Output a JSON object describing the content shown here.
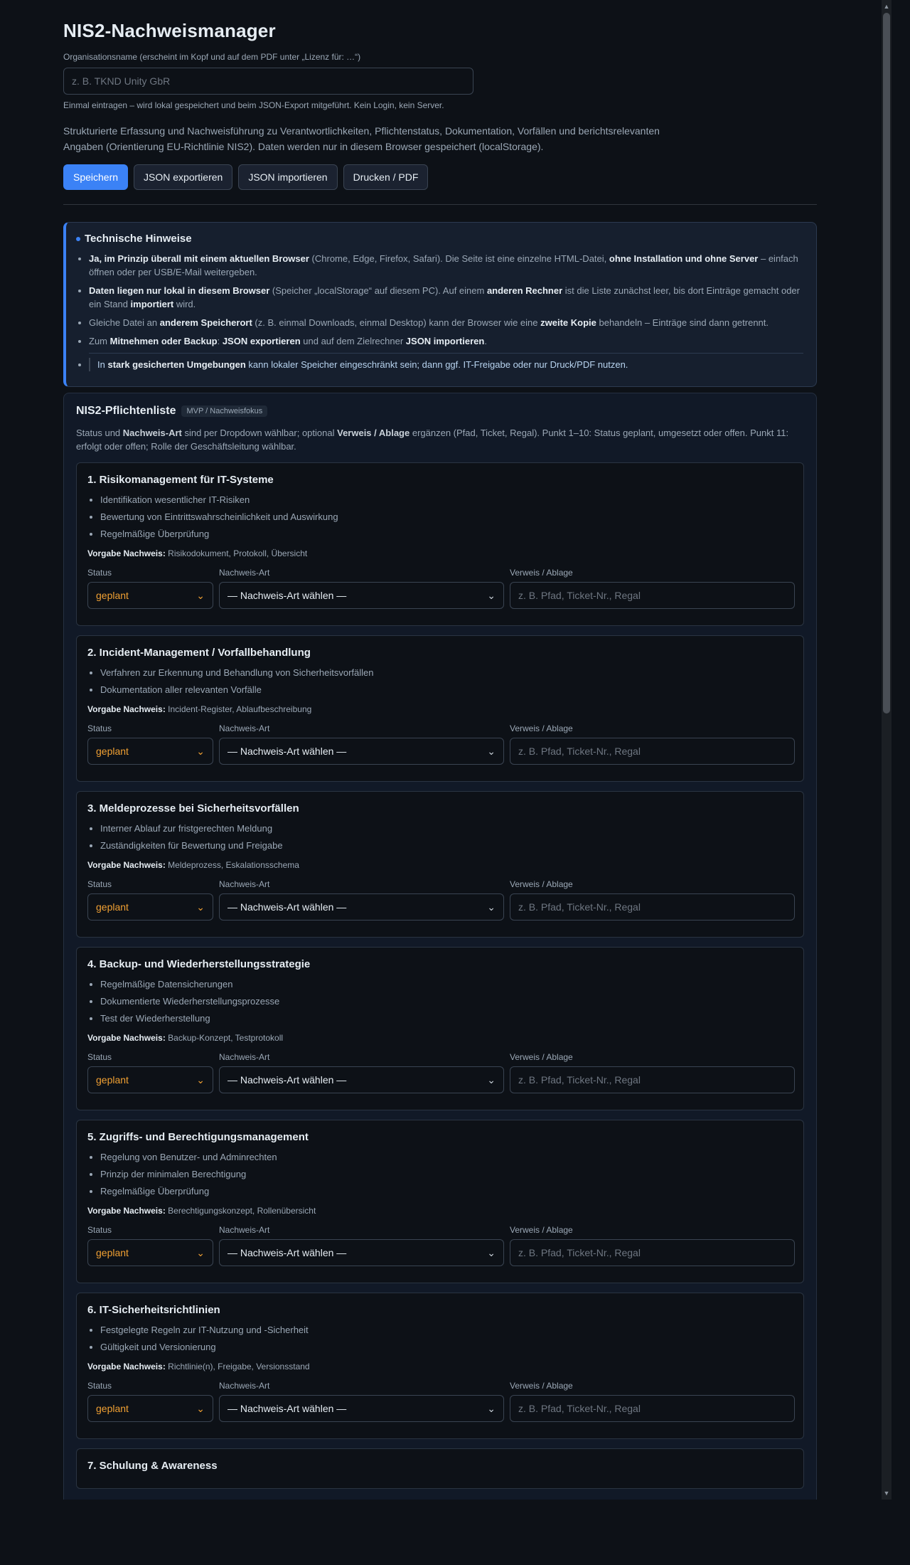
{
  "header": {
    "title": "NIS2-Nachweismanager",
    "org_label": "Organisationsname (erscheint im Kopf und auf dem PDF unter „Lizenz für: …“)",
    "org_placeholder": "z. B. TKND Unity GbR",
    "org_hint": "Einmal eintragen – wird lokal gespeichert und beim JSON-Export mitgeführt. Kein Login, kein Server.",
    "intro": "Strukturierte Erfassung und Nachweisführung zu Verantwortlichkeiten, Pflichtenstatus, Dokumentation, Vorfällen und berichtsrelevanten Angaben (Orientierung EU-Richtlinie NIS2). Daten werden nur in diesem Browser gespeichert (localStorage)."
  },
  "toolbar": {
    "save_label": "Speichern",
    "export_label": "JSON exportieren",
    "import_label": "JSON importieren",
    "print_label": "Drucken / PDF"
  },
  "hints": {
    "title": "Technische Hinweise",
    "items": [
      {
        "b1": "Ja, im Prinzip überall mit einem aktuellen Browser",
        "t1": " (Chrome, Edge, Firefox, Safari). Die Seite ist eine einzelne HTML-Datei, ",
        "b2": "ohne Installation und ohne Server",
        "t2": " – einfach öffnen oder per USB/E-Mail weitergeben."
      },
      {
        "b1": "Daten liegen nur lokal in diesem Browser",
        "t1": " (Speicher „localStorage“ auf diesem PC). Auf einem ",
        "b2": "anderen Rechner",
        "t2": " ist die Liste zunächst leer, bis dort Einträge gemacht oder ein Stand ",
        "b3": "importiert",
        "t3": " wird."
      },
      {
        "t0": "Gleiche Datei an ",
        "b1": "anderem Speicherort",
        "t1": " (z. B. einmal Downloads, einmal Desktop) kann der Browser wie eine ",
        "b2": "zweite Kopie",
        "t2": " behandeln – Einträge sind dann getrennt."
      },
      {
        "t0": "Zum ",
        "b1": "Mitnehmen oder Backup",
        "t1": ": ",
        "b2": "JSON exportieren",
        "t2": " und auf dem Zielrechner ",
        "b3": "JSON importieren",
        "t3": "."
      }
    ],
    "last_pre": "In ",
    "last_bold": "stark gesicherten Umgebungen",
    "last_post": " kann lokaler Speicher eingeschränkt sein; dann ggf. IT-Freigabe oder nur Druck/PDF nutzen."
  },
  "checklist": {
    "title": "NIS2-Pflichtenliste",
    "badge": "MVP / Nachweisfokus",
    "desc_pre": "Status und ",
    "desc_b1": "Nachweis-Art",
    "desc_mid": " sind per Dropdown wählbar; optional ",
    "desc_b2": "Verweis / Ablage",
    "desc_post": " ergänzen (Pfad, Ticket, Regal). Punkt 1–10: Status geplant, umgesetzt oder offen. Punkt 11: erfolgt oder offen; Rolle der Geschäftsleitung wählbar.",
    "req_label": "Vorgabe Nachweis:",
    "status_label": "Status",
    "type_label": "Nachweis-Art",
    "ref_label": "Verweis / Ablage",
    "status_value": "geplant",
    "type_value": "— Nachweis-Art wählen —",
    "ref_placeholder": "z. B. Pfad, Ticket-Nr., Regal",
    "status_color": "#f0a033",
    "items": [
      {
        "title": "1. Risikomanagement für IT-Systeme",
        "bullets": [
          "Identifikation wesentlicher IT-Risiken",
          "Bewertung von Eintrittswahrscheinlichkeit und Auswirkung",
          "Regelmäßige Überprüfung"
        ],
        "req": "Risikodokument, Protokoll, Übersicht"
      },
      {
        "title": "2. Incident-Management / Vorfallbehandlung",
        "bullets": [
          "Verfahren zur Erkennung und Behandlung von Sicherheitsvorfällen",
          "Dokumentation aller relevanten Vorfälle"
        ],
        "req": "Incident-Register, Ablaufbeschreibung"
      },
      {
        "title": "3. Meldeprozesse bei Sicherheitsvorfällen",
        "bullets": [
          "Interner Ablauf zur fristgerechten Meldung",
          "Zuständigkeiten für Bewertung und Freigabe"
        ],
        "req": "Meldeprozess, Eskalationsschema"
      },
      {
        "title": "4. Backup- und Wiederherstellungsstrategie",
        "bullets": [
          "Regelmäßige Datensicherungen",
          "Dokumentierte Wiederherstellungsprozesse",
          "Test der Wiederherstellung"
        ],
        "req": "Backup-Konzept, Testprotokoll"
      },
      {
        "title": "5. Zugriffs- und Berechtigungsmanagement",
        "bullets": [
          "Regelung von Benutzer- und Adminrechten",
          "Prinzip der minimalen Berechtigung",
          "Regelmäßige Überprüfung"
        ],
        "req": "Berechtigungskonzept, Rollenübersicht"
      },
      {
        "title": "6. IT-Sicherheitsrichtlinien",
        "bullets": [
          "Festgelegte Regeln zur IT-Nutzung und -Sicherheit",
          "Gültigkeit und Versionierung"
        ],
        "req": "Richtlinie(n), Freigabe, Versionsstand"
      },
      {
        "title": "7. Schulung & Awareness",
        "bullets": [],
        "req": ""
      }
    ]
  },
  "colors": {
    "accent": "#3b82f6",
    "background": "#0d1117",
    "status_text": "#f0a033"
  },
  "icons": {
    "dropdown": "chevron-down-icon",
    "scroll_up": "arrow-up-icon",
    "scroll_down": "arrow-down-icon"
  }
}
